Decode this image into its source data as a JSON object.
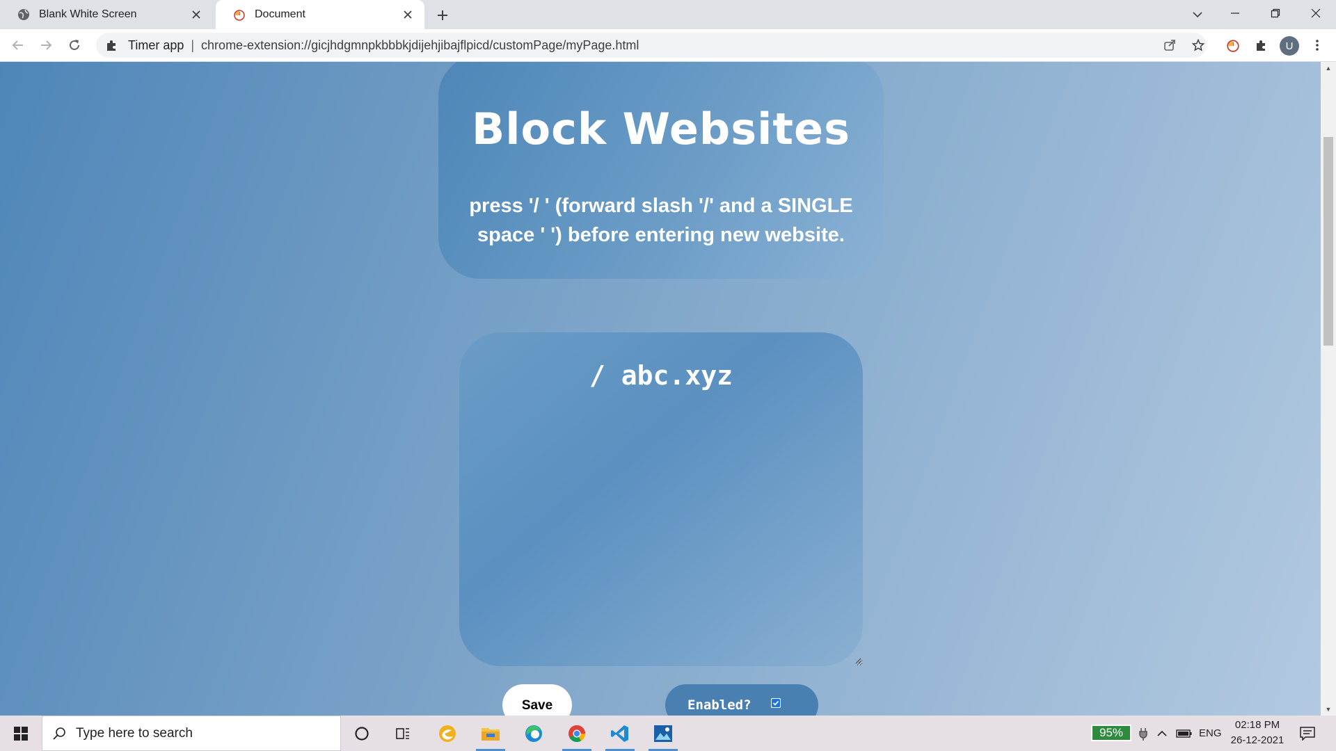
{
  "browser": {
    "tabs": [
      {
        "title": "Blank White Screen",
        "active": false
      },
      {
        "title": "Document",
        "active": true
      }
    ],
    "omnibox": {
      "extension_chip": "Timer app",
      "separator": "|",
      "url": "chrome-extension://gicjhdgmnpkbbbkjdijehjibajflpicd/customPage/myPage.html"
    },
    "profile_initial": "U"
  },
  "page": {
    "title": "Block Websites",
    "instructions": "press '/ ' (forward slash '/' and a SINGLE space ' ') before entering new website.",
    "site_list_value": "/ abc.xyz",
    "save_label": "Save",
    "enabled_label": "Enabled?",
    "enabled_checked": true
  },
  "taskbar": {
    "search_placeholder": "Type here to search",
    "battery_percent": "95%",
    "language": "ENG",
    "time": "02:18 PM",
    "date": "26-12-2021"
  },
  "colors": {
    "bg_gradient_start": "#4f86b8",
    "bg_gradient_end": "#b2c9e0",
    "pill_blue": "#4a7fb2",
    "battery_green": "#2e8b3e"
  }
}
